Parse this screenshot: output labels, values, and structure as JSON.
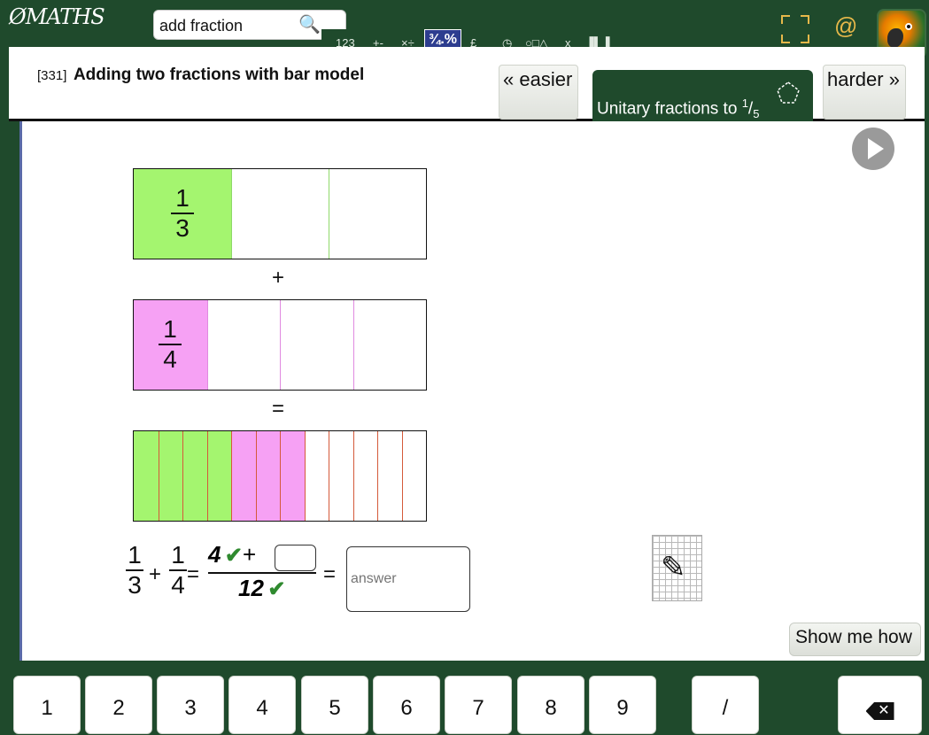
{
  "header": {
    "logo_text": "MATHS",
    "search_value": "add fraction",
    "toolbar": [
      "123",
      "+-",
      "×÷",
      "¾.%",
      "£",
      "◷",
      "○□△",
      "x",
      "▐▌▐"
    ],
    "active_tool": "¾.%",
    "at_label": "@"
  },
  "question": {
    "id": "[331]",
    "title": "Adding two fractions with bar model",
    "easier_label": "« easier",
    "harder_label": "harder »",
    "level_label": "Unitary fractions to",
    "level_sup": "1",
    "level_sub": "5"
  },
  "bars": {
    "first": {
      "numerator": "1",
      "denominator": "3",
      "parts": 3,
      "shaded": 1,
      "color": "#a4f56f",
      "divider": "#8fd86a"
    },
    "second": {
      "numerator": "1",
      "denominator": "4",
      "parts": 4,
      "shaded": 1,
      "color": "#f6a1f4",
      "divider": "#e08ae0"
    },
    "result": {
      "parts": 12,
      "green": 4,
      "pink": 3,
      "divider": "#d45a3a"
    },
    "plus": "+",
    "equals": "="
  },
  "equation": {
    "a_num": "1",
    "a_den": "3",
    "plus": "+",
    "b_num": "1",
    "b_den": "4",
    "eq1": "=",
    "num_given": "4",
    "num_plus": "+",
    "den": "12",
    "check": "✔",
    "eq2": "=",
    "answer_placeholder": "answer"
  },
  "show_me_label": "Show me how",
  "keypad": [
    "1",
    "2",
    "3",
    "4",
    "5",
    "6",
    "7",
    "8",
    "9",
    "/"
  ],
  "backspace_glyph": "✕",
  "colors": {
    "bg": "#1f4a2c",
    "green": "#a4f56f",
    "pink": "#f6a1f4",
    "accent": "#e6b84a"
  }
}
